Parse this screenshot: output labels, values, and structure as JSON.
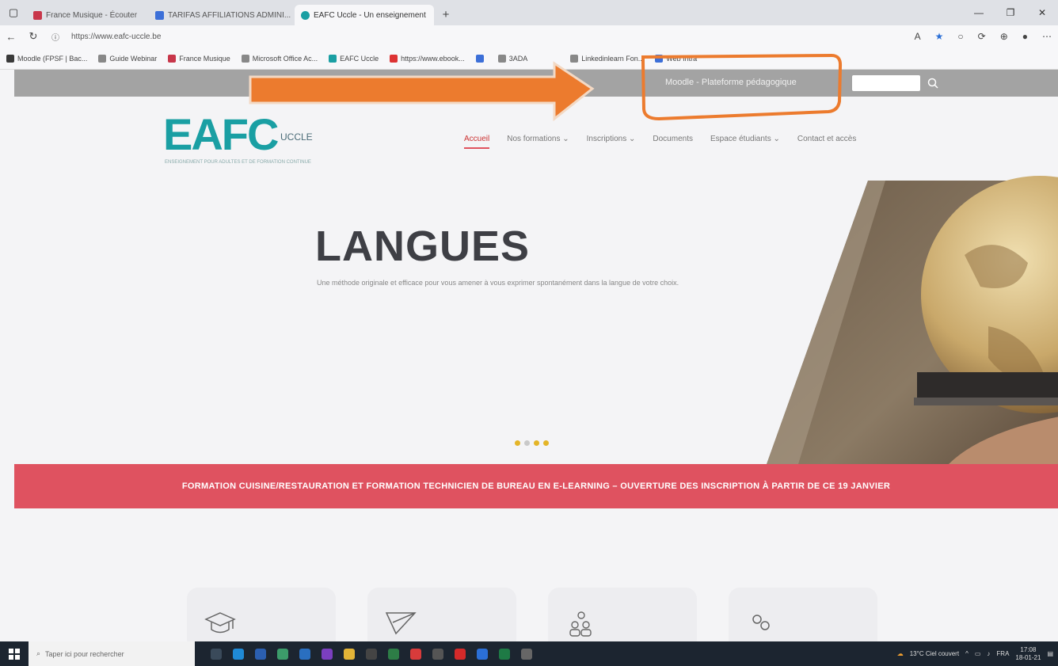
{
  "browser": {
    "tabs": [
      {
        "label": "France Musique - Écouter",
        "color": "#c8364a",
        "active": false
      },
      {
        "label": "TARIFAS AFFILIATIONS ADMINI...",
        "color": "#3c6fd8",
        "active": false
      },
      {
        "label": "EAFC Uccle - Un enseignement",
        "color": "#1a9fa3",
        "active": true
      }
    ],
    "new_tab": "+",
    "address": "https://www.eafc-uccle.be",
    "bookmarks": [
      {
        "label": "Moodle (FPSF | Bac...",
        "color": "#3a3a3a"
      },
      {
        "label": "Guide Webinar",
        "color": "#888888"
      },
      {
        "label": "France Musique",
        "color": "#c8364a"
      },
      {
        "label": "Microsoft Office Ac...",
        "color": "#888888"
      },
      {
        "label": "EAFC Uccle",
        "color": "#1a9fa3"
      },
      {
        "label": "https://www.ebook...",
        "color": "#d33"
      },
      {
        "label": "",
        "color": "#3c6fd8"
      },
      {
        "label": "3ADA",
        "color": "#888888"
      },
      {
        "label": "Linkedinlearn Fon...",
        "color": "#888888"
      },
      {
        "label": "Web Intra",
        "color": "#3c6fd8"
      }
    ]
  },
  "site": {
    "topbar_link": "Moodle - Plateforme pédagogique",
    "logo": {
      "main": "EAFC",
      "sub": "UCCLE",
      "tagline": "ENSEIGNEMENT POUR ADULTES ET DE FORMATION CONTINUE"
    },
    "nav": [
      {
        "label": "Accueil",
        "active": true
      },
      {
        "label": "Nos formations  ⌄",
        "active": false
      },
      {
        "label": "Inscriptions  ⌄",
        "active": false
      },
      {
        "label": "Documents",
        "active": false
      },
      {
        "label": "Espace étudiants  ⌄",
        "active": false
      },
      {
        "label": "Contact et accès",
        "active": false
      }
    ],
    "hero": {
      "title": "LANGUES",
      "text": "Une méthode originale et efficace pour vous amener à vous exprimer spontanément dans la langue de votre choix."
    },
    "banner": "FORMATION CUISINE/RESTAURATION ET FORMATION TECHNICIEN DE BUREAU EN E-LEARNING – OUVERTURE DES INSCRIPTION À PARTIR DE CE 19 JANVIER",
    "cards": [
      {
        "icon": "graduation-cap-icon"
      },
      {
        "icon": "paper-plane-icon"
      },
      {
        "icon": "people-icon"
      },
      {
        "icon": "link-icon"
      }
    ]
  },
  "taskbar": {
    "search_placeholder": "Taper ici pour rechercher",
    "weather": "13°C  Ciel couvert",
    "time": "17:08",
    "date": "18-01-21",
    "lang": "FRA"
  },
  "colors": {
    "brand_teal": "#1a9fa3",
    "banner_red": "#df5260",
    "annotation_orange": "#ec7b2e"
  }
}
